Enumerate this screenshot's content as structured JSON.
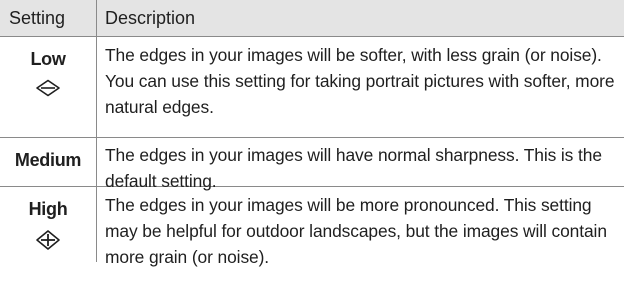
{
  "table": {
    "headers": {
      "setting": "Setting",
      "description": "Description"
    },
    "rows": [
      {
        "setting": "Low",
        "icon": "soft-sharpness-icon",
        "description": "The edges in your images will be softer, with less grain (or noise). You can use this setting for taking portrait pictures with softer, more natural edges."
      },
      {
        "setting": "Medium",
        "icon": "",
        "description": "The edges in your images will have normal sharpness. This is the default setting."
      },
      {
        "setting": "High",
        "icon": "high-sharpness-icon",
        "description": "The edges in your images will be more pronounced. This setting may be helpful for outdoor landscapes, but the images will contain more grain (or noise)."
      }
    ]
  }
}
